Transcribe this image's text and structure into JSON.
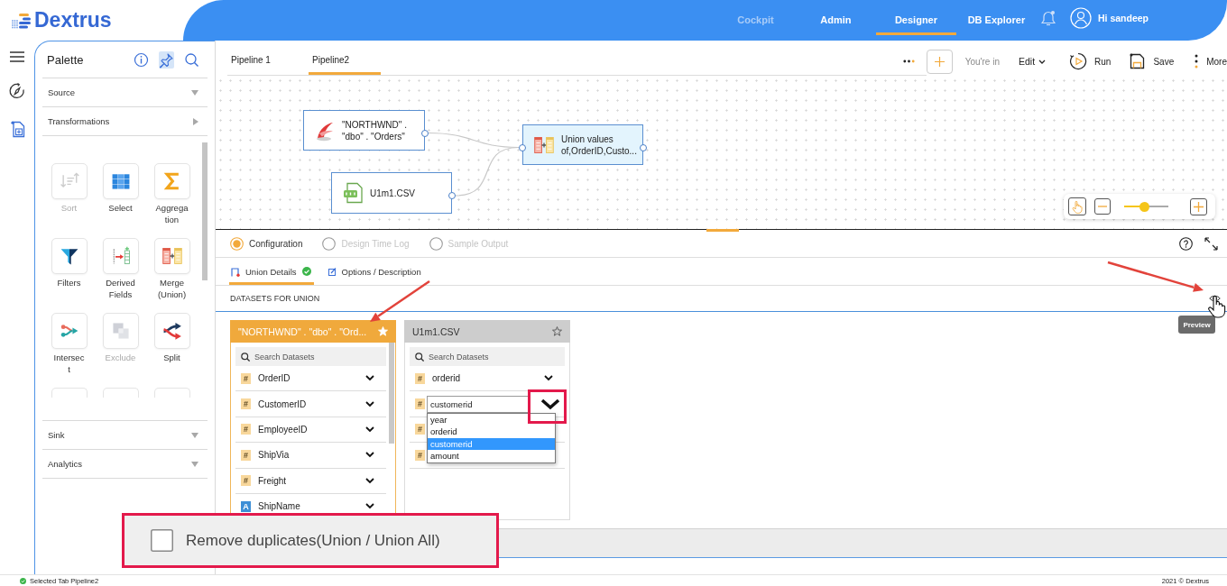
{
  "header": {
    "logo": "Dextrus",
    "nav": [
      {
        "label": "Cockpit",
        "selected": false,
        "disabled": true
      },
      {
        "label": "Admin",
        "selected": false,
        "disabled": false
      },
      {
        "label": "Designer",
        "selected": true,
        "disabled": false
      },
      {
        "label": "DB Explorer",
        "selected": false,
        "disabled": false
      }
    ],
    "notifications": {
      "unread": true
    },
    "user": "Hi sandeep"
  },
  "rail": [
    {
      "kind": "menu",
      "selected": false
    },
    {
      "kind": "compass",
      "selected": false
    },
    {
      "kind": "add-file",
      "selected": true
    }
  ],
  "palette": {
    "title": "Palette",
    "tools": [
      {
        "kind": "info",
        "selected": false
      },
      {
        "kind": "pin",
        "selected": true
      },
      {
        "kind": "search",
        "selected": false
      }
    ],
    "sections": [
      {
        "label": "Source",
        "expanded": false
      },
      {
        "label": "Transformations",
        "expanded": true,
        "tiles": [
          {
            "kind": "sort",
            "label": "Sort",
            "disabled": true
          },
          {
            "kind": "select",
            "label": "Select",
            "disabled": false
          },
          {
            "kind": "aggregation",
            "label": "Aggregation",
            "disabled": false
          },
          {
            "kind": "filters",
            "label": "Filters",
            "disabled": false
          },
          {
            "kind": "derived",
            "label": "Derived Fields",
            "disabled": false
          },
          {
            "kind": "merge",
            "label": "Merge (Union)",
            "disabled": false
          },
          {
            "kind": "intersect",
            "label": "Intersect",
            "disabled": false
          },
          {
            "kind": "exclude",
            "label": "Exclude",
            "disabled": true
          },
          {
            "kind": "split",
            "label": "Split",
            "disabled": false
          },
          {
            "kind": "cut"
          },
          {
            "kind": "cut"
          },
          {
            "kind": "cut"
          }
        ]
      },
      {
        "label": "Sink",
        "expanded": false
      },
      {
        "label": "Analytics",
        "expanded": false
      }
    ]
  },
  "pipeline_tabs": [
    {
      "label": "Pipeline 1",
      "selected": false
    },
    {
      "label": "Pipeline2",
      "selected": true
    }
  ],
  "toolbar": {
    "mode_caption": "You're in",
    "mode": "Edit",
    "actions": [
      {
        "kind": "run",
        "label": "Run"
      },
      {
        "kind": "save",
        "label": "Save"
      },
      {
        "kind": "more",
        "label": "More"
      }
    ]
  },
  "canvas": {
    "nodes": [
      {
        "kind": "sqlserver",
        "label": "\"NORTHWND\" . \"dbo\" . \"Orders\"",
        "selected": false
      },
      {
        "kind": "csv",
        "label": "U1m1.CSV",
        "selected": false
      },
      {
        "kind": "union",
        "label": "Union values of,OrderID,Custo...",
        "selected": true
      }
    ],
    "zoom": {
      "level": 0.45
    }
  },
  "config": {
    "modes": [
      {
        "label": "Configuration",
        "selected": true,
        "disabled": false
      },
      {
        "label": "Design Time Log",
        "selected": false,
        "disabled": true
      },
      {
        "label": "Sample Output",
        "selected": false,
        "disabled": true
      }
    ],
    "tabs": [
      {
        "kind": "union",
        "label": "Union Details",
        "selected": true,
        "valid": true
      },
      {
        "kind": "options",
        "label": "Options / Description",
        "selected": false,
        "valid": false
      }
    ],
    "section_title": "DATASETS FOR UNION",
    "datasets": [
      {
        "title": "\"NORTHWND\" . \"dbo\" . \"Ord...",
        "selected": true,
        "starred": true,
        "search_placeholder": "Search Datasets",
        "fields": [
          {
            "kind": "number",
            "badge": "#",
            "name": "OrderID"
          },
          {
            "kind": "number",
            "badge": "#",
            "name": "CustomerID"
          },
          {
            "kind": "number",
            "badge": "#",
            "name": "EmployeeID"
          },
          {
            "kind": "number",
            "badge": "#",
            "name": "ShipVia"
          },
          {
            "kind": "number",
            "badge": "#",
            "name": "Freight"
          },
          {
            "kind": "text",
            "badge": "A",
            "name": "ShipName"
          }
        ]
      },
      {
        "title": "U1m1.CSV",
        "selected": false,
        "starred": false,
        "search_placeholder": "Search Datasets",
        "fields": [
          {
            "kind": "number",
            "badge": "#",
            "name": "orderid"
          },
          {
            "kind": "number",
            "badge": "#",
            "mapping": {
              "value": "customerid",
              "options": [
                {
                  "label": "year",
                  "selected": false
                },
                {
                  "label": "orderid",
                  "selected": false
                },
                {
                  "label": "customerid",
                  "selected": true
                },
                {
                  "label": "amount",
                  "selected": false
                }
              ]
            }
          },
          {
            "kind": "number",
            "badge": "#"
          },
          {
            "kind": "number",
            "badge": "#"
          }
        ]
      }
    ],
    "remove_duplicates": {
      "checked": false,
      "label": "Remove duplicates(Union / Union All)"
    }
  },
  "annotations": [
    {
      "kind": "arrow"
    },
    {
      "kind": "arrow"
    },
    {
      "kind": "highlight"
    },
    {
      "kind": "callout"
    }
  ],
  "tooltip": {
    "text": "Preview"
  },
  "status_bar": {
    "left": "Selected Tab Pipeline2",
    "right": "2021 © Dextrus"
  }
}
